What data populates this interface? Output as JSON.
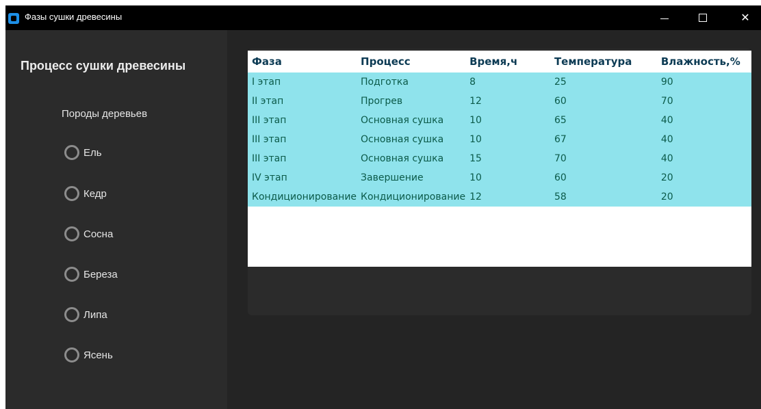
{
  "window": {
    "title": "Фазы сушки древесины",
    "controls": {
      "minimize": "",
      "maximize": "",
      "close": "✕"
    }
  },
  "sidebar": {
    "title": "Процесс сушки древесины",
    "species_label": "Породы деревьев",
    "options": [
      {
        "label": "Ель",
        "selected": false
      },
      {
        "label": "Кедр",
        "selected": false
      },
      {
        "label": "Сосна",
        "selected": false
      },
      {
        "label": "Береза",
        "selected": false
      },
      {
        "label": "Липа",
        "selected": false
      },
      {
        "label": "Ясень",
        "selected": false
      }
    ]
  },
  "table": {
    "columns": [
      "Фаза",
      "Процесс",
      "Время,ч",
      "Температура",
      "Влажность,%"
    ],
    "rows": [
      [
        "I этап",
        "Подготка",
        "8",
        "25",
        "90"
      ],
      [
        "II этап",
        "Прогрев",
        "12",
        "60",
        "70"
      ],
      [
        "III этап",
        "Основная сушка",
        "10",
        "65",
        "40"
      ],
      [
        "III этап",
        "Основная сушка",
        "10",
        "67",
        "40"
      ],
      [
        "III этап",
        "Основная сушка",
        "15",
        "70",
        "40"
      ],
      [
        "IV этап",
        "Завершение",
        "10",
        "60",
        "20"
      ],
      [
        "Кондиционирование",
        "Кондиционирование",
        "12",
        "58",
        "20"
      ]
    ]
  },
  "colors": {
    "row_background": "#8fe3ec",
    "header_text": "#0d3b54",
    "cell_text": "#0b5a49",
    "app_icon": "#1d8fe6"
  }
}
